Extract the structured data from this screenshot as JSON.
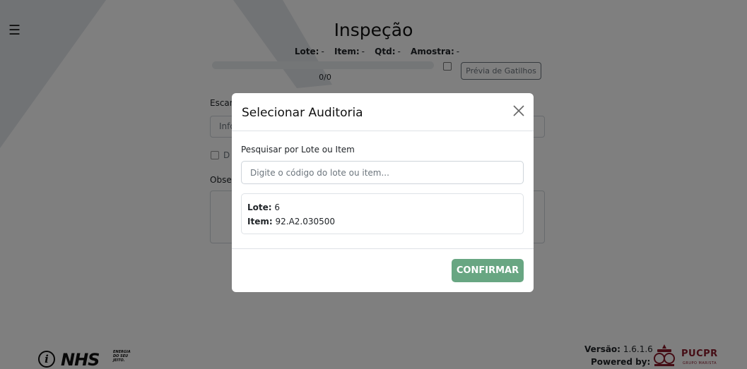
{
  "app": {
    "title": "Inspeção",
    "menu_icon": "hamburger-menu-icon"
  },
  "inspection": {
    "lote_label": "Lote:",
    "lote_value": "-",
    "item_label": "Item:",
    "item_value": "-",
    "qtd_label": "Qtd:",
    "qtd_value": "-",
    "amostra_label": "Amostra:",
    "amostra_value": "-",
    "progress_text": "0/0",
    "progress_fraction": 0,
    "preview_button": "Prévia de Gatilhos"
  },
  "background_form": {
    "scan_label": "Escan",
    "input_text": "Info",
    "checkbox_label": "D",
    "obs_label": "Obse"
  },
  "modal": {
    "title": "Selecionar Auditoria",
    "search_label": "Pesquisar por Lote ou Item",
    "search_placeholder": "Digite o código do lote ou item...",
    "search_value": "",
    "results": [
      {
        "lote_label": "Lote:",
        "lote_value": "6",
        "item_label": "Item:",
        "item_value": "92.A2.030500"
      }
    ],
    "confirm_button": "CONFIRMAR",
    "confirm_color": "#68a682"
  },
  "footer": {
    "logo_text": "NHS",
    "logo_tagline": "ENERGIA DO SEU JEITO.",
    "version_label": "Versão:",
    "version_value": "1.6.1.6",
    "powered_label": "Powered by:",
    "partner_logo": "PUCPR",
    "partner_sub": "GRUPO MARISTA"
  },
  "colors": {
    "overlay": "rgba(0,0,0,0.5)",
    "confirm": "#68a682",
    "pucpr": "#8b1a2b"
  }
}
